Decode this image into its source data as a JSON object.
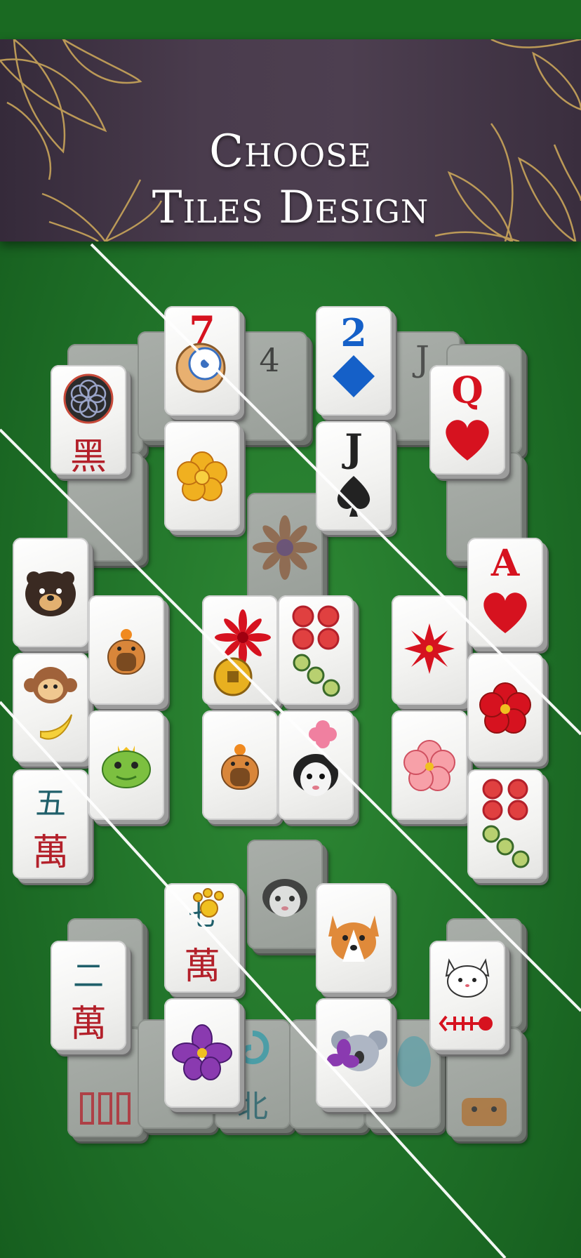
{
  "banner": {
    "line1": "Choose",
    "line2": "Tiles Design"
  },
  "colors": {
    "felt": "#1f7028",
    "banner": "#4a3c4d",
    "gold": "#c9a55a",
    "red_suit": "#d6121f",
    "blue_suit": "#1560c8",
    "mahjong_red": "#b3202a",
    "mahjong_teal": "#1f5f6a"
  },
  "tiles": {
    "kuro": "黑",
    "seven": "7",
    "two": "2",
    "jack": "J",
    "queen": "Q",
    "ace": "A",
    "wu": "五",
    "wan": "萬",
    "er": "二",
    "qi": "七",
    "bei": "北",
    "back_four": "4",
    "back_jack": "J"
  }
}
